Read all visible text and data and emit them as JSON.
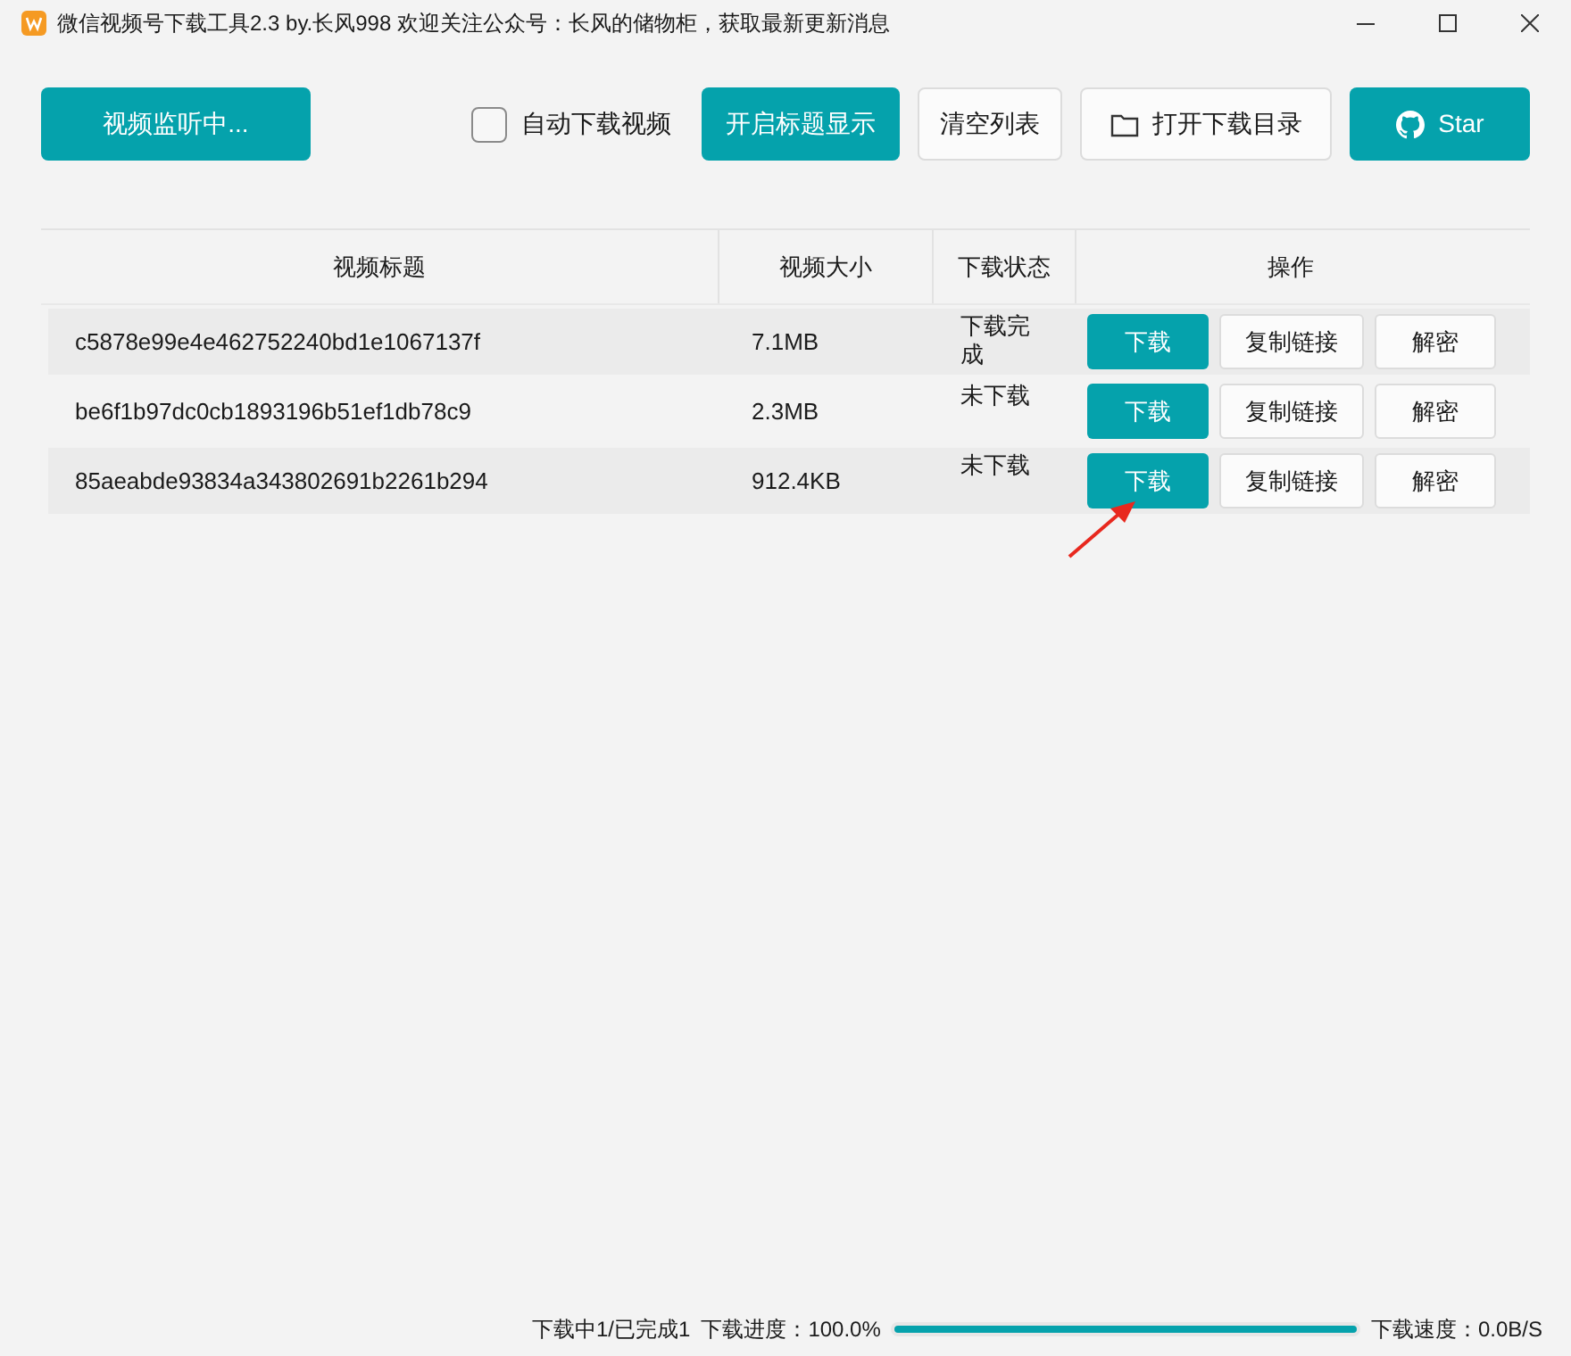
{
  "window": {
    "title": "微信视频号下载工具2.3 by.长风998  欢迎关注公众号：长风的储物柜，获取最新更新消息"
  },
  "toolbar": {
    "monitor_button": "视频监听中...",
    "auto_download": {
      "label": "自动下载视频",
      "checked": false
    },
    "buttons": [
      {
        "label": "开启标题显示",
        "kind": "primary"
      },
      {
        "label": "清空列表",
        "kind": "plain"
      },
      {
        "label": "打开下载目录",
        "kind": "folder"
      },
      {
        "label": "Star",
        "kind": "github"
      }
    ]
  },
  "table": {
    "columns": [
      "视频标题",
      "视频大小",
      "下载状态",
      "操作"
    ],
    "rows": [
      {
        "title": "c5878e99e4e462752240bd1e1067137f",
        "size": "7.1MB",
        "status": "下载完成",
        "actions": [
          "下载",
          "复制链接",
          "解密"
        ]
      },
      {
        "title": "be6f1b97dc0cb1893196b51ef1db78c9",
        "size": "2.3MB",
        "status": "未下载",
        "actions": [
          "下载",
          "复制链接",
          "解密"
        ]
      },
      {
        "title": "85aeabde93834a343802691b2261b294",
        "size": "912.4KB",
        "status": "未下载",
        "actions": [
          "下载",
          "复制链接",
          "解密"
        ]
      }
    ]
  },
  "status_bar": {
    "counts": "下载中1/已完成1",
    "progress_label": "下载进度：100.0%",
    "level": 1.0,
    "speed": "下载速度：0.0B/S"
  }
}
